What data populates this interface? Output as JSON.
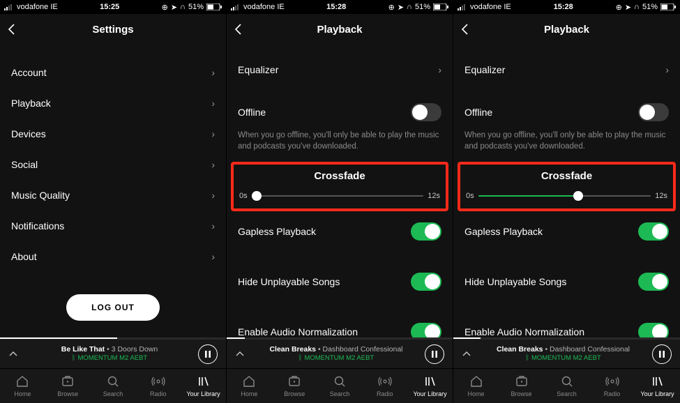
{
  "status": {
    "carrier": "vodafone IE",
    "battery": "51%"
  },
  "screens": [
    {
      "time": "15:25",
      "title": "Settings",
      "settings_items": [
        "Account",
        "Playback",
        "Devices",
        "Social",
        "Music Quality",
        "Notifications",
        "About"
      ],
      "logout": "LOG OUT",
      "now_playing": {
        "track": "Be Like That",
        "artist": "3 Doors Down",
        "device": "MOMENTUM M2 AEBT"
      },
      "progress_pct": 52
    },
    {
      "time": "15:28",
      "title": "Playback",
      "equalizer": "Equalizer",
      "offline_label": "Offline",
      "offline_desc": "When you go offline, you'll only be able to play the music and podcasts you've downloaded.",
      "crossfade_label": "Crossfade",
      "crossfade_min": "0s",
      "crossfade_max": "12s",
      "crossfade_pct": 3,
      "gapless": "Gapless Playback",
      "hide_unplayable": "Hide Unplayable Songs",
      "audio_norm": "Enable Audio Normalization",
      "now_playing": {
        "track": "Clean Breaks",
        "artist": "Dashboard Confessional",
        "device": "MOMENTUM M2 AEBT"
      },
      "progress_pct": 8
    },
    {
      "time": "15:28",
      "title": "Playback",
      "equalizer": "Equalizer",
      "offline_label": "Offline",
      "offline_desc": "When you go offline, you'll only be able to play the music and podcasts you've downloaded.",
      "crossfade_label": "Crossfade",
      "crossfade_min": "0s",
      "crossfade_max": "12s",
      "crossfade_pct": 58,
      "gapless": "Gapless Playback",
      "hide_unplayable": "Hide Unplayable Songs",
      "audio_norm": "Enable Audio Normalization",
      "now_playing": {
        "track": "Clean Breaks",
        "artist": "Dashboard Confessional",
        "device": "MOMENTUM M2 AEBT"
      },
      "progress_pct": 12
    }
  ],
  "tabs": [
    "Home",
    "Browse",
    "Search",
    "Radio",
    "Your Library"
  ]
}
